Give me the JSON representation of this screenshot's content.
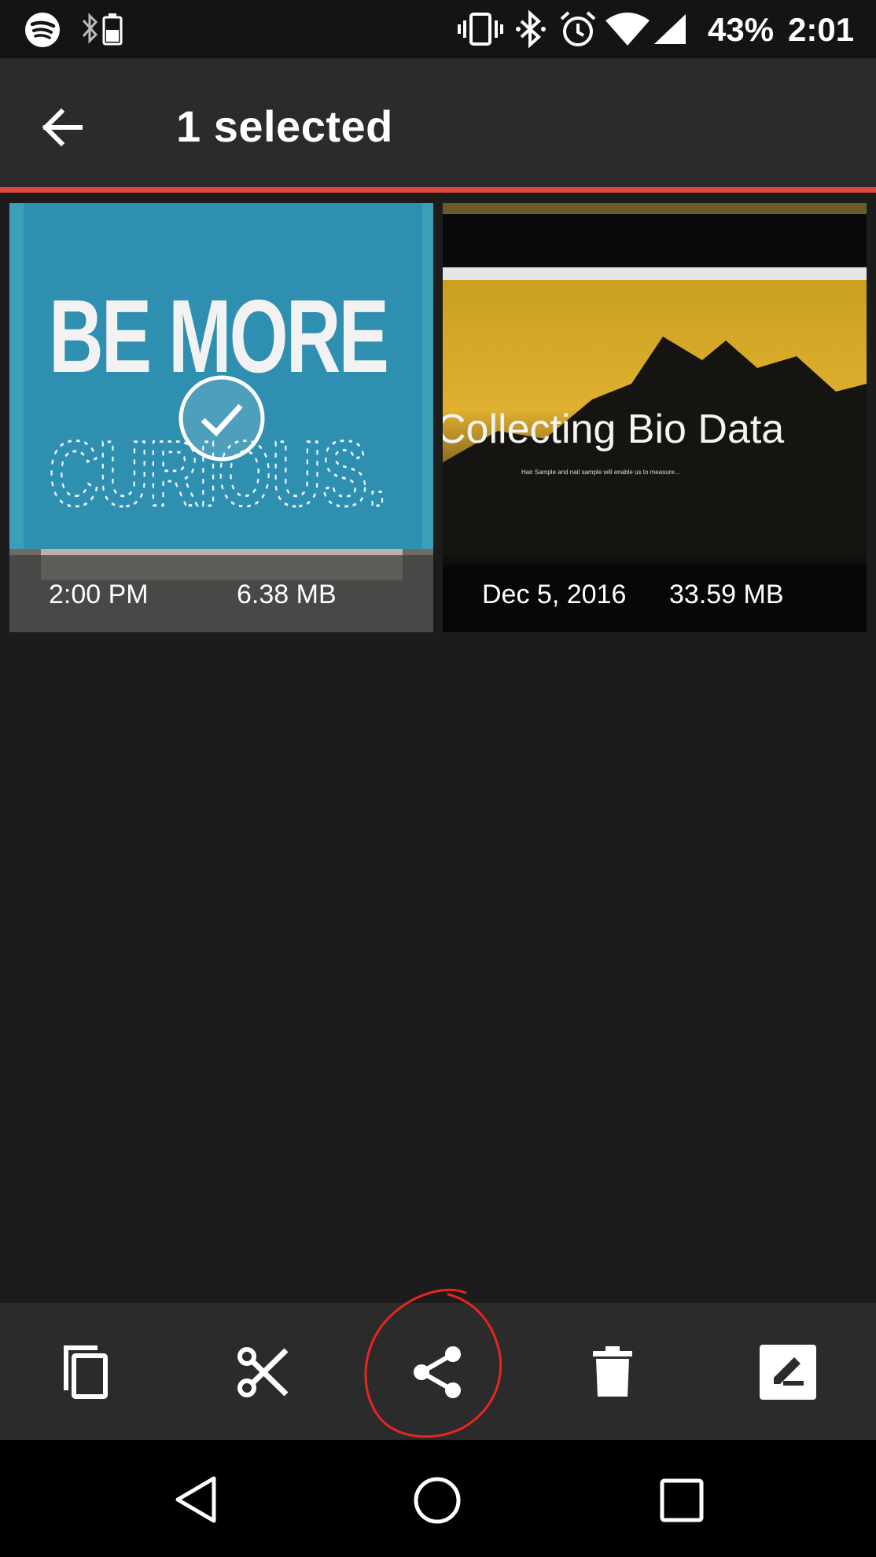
{
  "status_bar": {
    "battery_percent": "43%",
    "time": "2:01"
  },
  "app_bar": {
    "title": "1 selected"
  },
  "photos": [
    {
      "time": "2:00 PM",
      "size": "6.38 MB",
      "selected": true,
      "poster_line1": "BE MORE",
      "poster_line2": "CURIOUS."
    },
    {
      "time": "Dec 5, 2016",
      "size": "33.59 MB",
      "selected": false,
      "slide_title": "Collecting Bio Data",
      "slide_subtitle": "Hair Sample and nail sample will enable us to measure..."
    }
  ],
  "actions": [
    "copy",
    "cut",
    "share",
    "delete",
    "rename"
  ],
  "annotation_color": "#e8261f",
  "accent_color": "#e5463a"
}
